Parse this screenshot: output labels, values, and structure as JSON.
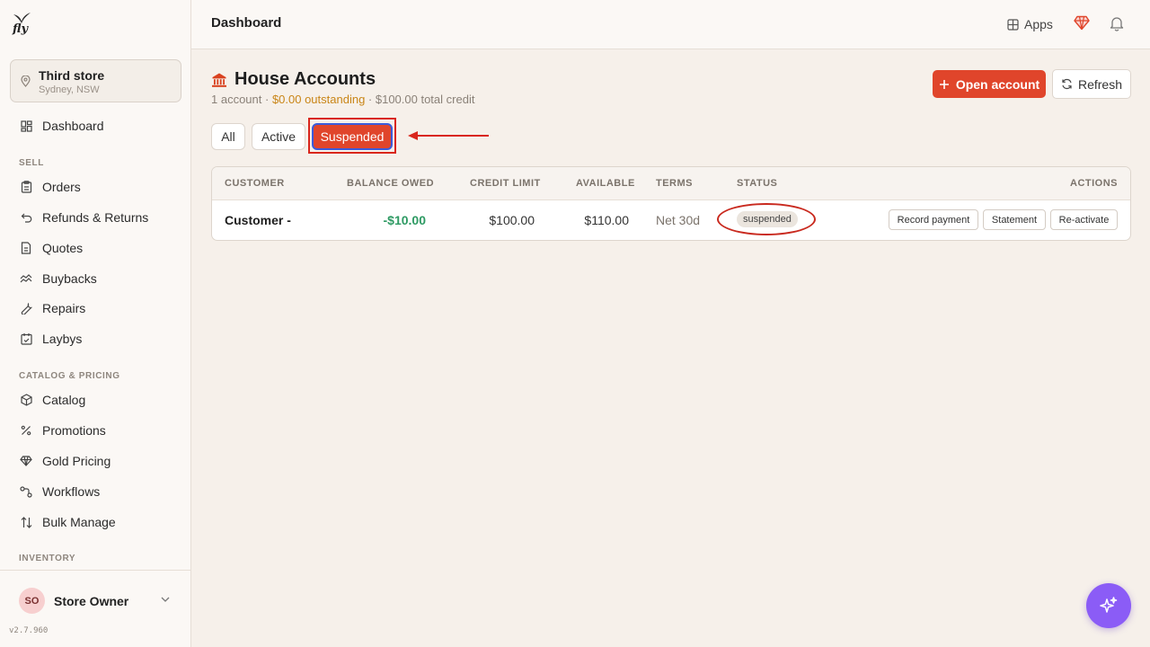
{
  "brand": {
    "logo_text": "fly"
  },
  "store": {
    "name": "Third store",
    "location": "Sydney, NSW"
  },
  "sidebar": {
    "dashboard": "Dashboard",
    "sell_label": "SELL",
    "sell_items": [
      "Orders",
      "Refunds & Returns",
      "Quotes",
      "Buybacks",
      "Repairs",
      "Laybys"
    ],
    "catalog_label": "CATALOG & PRICING",
    "catalog_items": [
      "Catalog",
      "Promotions",
      "Gold Pricing",
      "Workflows",
      "Bulk Manage"
    ],
    "inventory_label": "INVENTORY"
  },
  "user": {
    "initials": "SO",
    "name": "Store Owner"
  },
  "version": "v2.7.960",
  "header": {
    "title": "Dashboard",
    "apps_label": "Apps"
  },
  "page": {
    "title": "House Accounts",
    "subtitle_count": "1 account · ",
    "subtitle_outstanding": "$0.00 outstanding",
    "subtitle_credit": " · $100.00 total credit",
    "open_account_label": "Open account",
    "refresh_label": "Refresh"
  },
  "filters": {
    "all": "All",
    "active": "Active",
    "suspended": "Suspended",
    "selected": "Suspended"
  },
  "table": {
    "headers": {
      "customer": "CUSTOMER",
      "balance": "BALANCE OWED",
      "credit": "CREDIT LIMIT",
      "available": "AVAILABLE",
      "terms": "TERMS",
      "status": "STATUS",
      "actions": "ACTIONS"
    },
    "rows": [
      {
        "customer": "Customer -",
        "balance": "-$10.00",
        "credit": "$100.00",
        "available": "$110.00",
        "terms": "Net 30d",
        "status": "suspended",
        "actions": [
          "Record payment",
          "Statement",
          "Re-activate"
        ]
      }
    ]
  },
  "colors": {
    "accent": "#e0452b",
    "positive": "#2e9a63",
    "outstanding": "#c98516",
    "fab": "#8b5cf6",
    "annotation": "#d9261c"
  },
  "icons": [
    "store-pin-icon",
    "dashboard-icon",
    "orders-icon",
    "refunds-icon",
    "quotes-icon",
    "buybacks-icon",
    "repairs-icon",
    "laybys-icon",
    "catalog-icon",
    "promotions-icon",
    "gold-pricing-icon",
    "workflows-icon",
    "bulk-manage-icon",
    "apps-icon",
    "gem-icon",
    "bell-icon",
    "bank-icon",
    "plus-icon",
    "refresh-icon",
    "sparkle-icon"
  ]
}
